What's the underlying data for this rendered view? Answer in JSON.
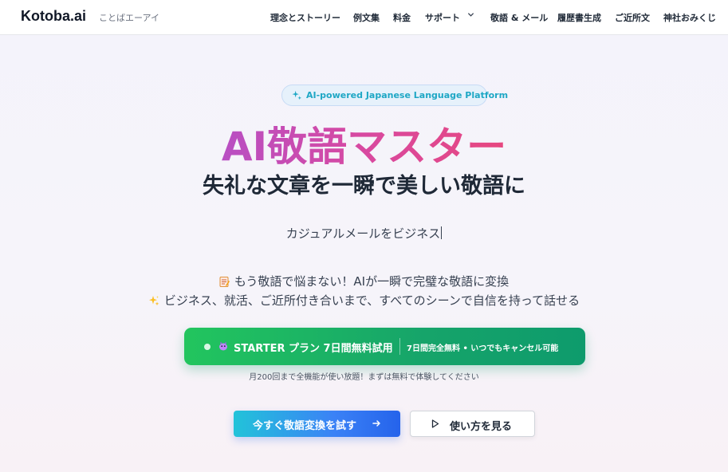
{
  "header": {
    "logo": "Kotoba.ai",
    "logo_sub": "ことばエーアイ",
    "nav": [
      "理念とストーリー",
      "例文集",
      "料金",
      "サポート",
      "敬語 & メール",
      "履歴書生成",
      "ご近所文",
      "神社おみくじ"
    ]
  },
  "hero": {
    "badge": "AI-powered Japanese Language Platform",
    "title": "AI敬語マスター",
    "subtitle": "失礼な文章を一瞬で美しい敬語に",
    "typing_text": "カジュアルメールをビジネス",
    "line1": "もう敬語で悩まない！AIが一瞬で完璧な敬語に変換",
    "line2": "ビジネス、就活、ご近所付き合いまで、すべてのシーンで自信を持って話せる"
  },
  "cta": {
    "label": "STARTER プラン 7日間無料試用",
    "note": "7日間完全無料 • いつでもキャンセル可能",
    "caption": "月200回まで全機能が使い放題！まずは無料で体験してください"
  },
  "buttons": {
    "try_label": "今すぐ敬語変換を試す",
    "how_label": "使い方を見る"
  },
  "icons": {
    "badge": "sparkle-icon",
    "support_dropdown": "chevron-down-icon",
    "line1": "memo-emoji-icon",
    "line2": "sparkles-emoji-icon",
    "cta": "dragon-emoji-icon",
    "try_button": "arrow-right-icon",
    "how_button": "play-icon"
  },
  "colors": {
    "title_gradient": [
      "#b84fc3",
      "#e7477f"
    ],
    "cta_green": "#16a46a",
    "try_gradient": [
      "#22c3d9",
      "#2563eb"
    ],
    "badge_text": "#1ea7c5"
  }
}
